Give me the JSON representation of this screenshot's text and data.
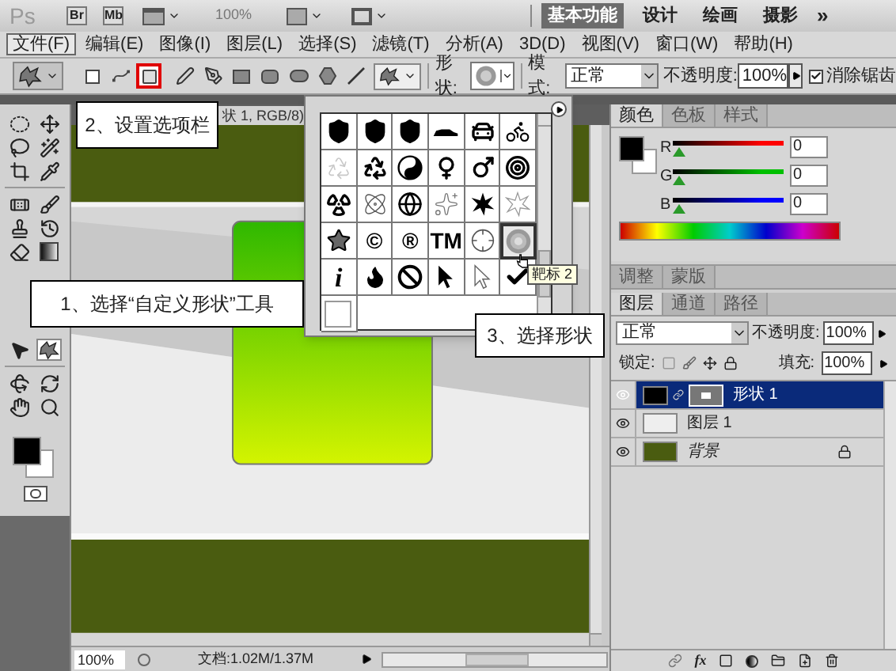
{
  "app_bar": {
    "logo": "Ps",
    "bridges": [
      "Br",
      "Mb"
    ],
    "zoom": "100%",
    "workspaces": [
      {
        "label": "基本功能",
        "selected": true
      },
      {
        "label": "设计",
        "selected": false
      },
      {
        "label": "绘画",
        "selected": false
      },
      {
        "label": "摄影",
        "selected": false
      }
    ],
    "more": "»"
  },
  "menu": [
    {
      "label": "文件(F)",
      "selected": true
    },
    {
      "label": "编辑(E)",
      "selected": false
    },
    {
      "label": "图像(I)",
      "selected": false
    },
    {
      "label": "图层(L)",
      "selected": false
    },
    {
      "label": "选择(S)",
      "selected": false
    },
    {
      "label": "滤镜(T)",
      "selected": false
    },
    {
      "label": "分析(A)",
      "selected": false
    },
    {
      "label": "3D(D)",
      "selected": false
    },
    {
      "label": "视图(V)",
      "selected": false
    },
    {
      "label": "窗口(W)",
      "selected": false
    },
    {
      "label": "帮助(H)",
      "selected": false
    }
  ],
  "options_bar": {
    "modes": [
      {
        "kind": "shape-layer",
        "selected": false
      },
      {
        "kind": "paths",
        "selected": false
      },
      {
        "kind": "fill-pixels",
        "selected": true
      }
    ],
    "tools": [
      {
        "kind": "pen"
      },
      {
        "kind": "freeform-pen"
      },
      {
        "kind": "rectangle"
      },
      {
        "kind": "rounded-rectangle"
      },
      {
        "kind": "ellipse"
      },
      {
        "kind": "polygon"
      },
      {
        "kind": "line"
      },
      {
        "kind": "custom-shape"
      }
    ],
    "shape_label": "形状:",
    "mode_label": "模式:",
    "mode_value": "正常",
    "opacity_label": "不透明度:",
    "opacity_value": "100%",
    "antialias": {
      "label": "消除锯齿",
      "checked": true
    }
  },
  "toolbox": {
    "tools": [
      {
        "kind": "ellipse-marquee",
        "selected": false
      },
      {
        "kind": "move",
        "selected": false
      },
      {
        "kind": "lasso",
        "selected": false
      },
      {
        "kind": "magic-wand",
        "selected": false
      },
      {
        "kind": "crop",
        "selected": false
      },
      {
        "kind": "eyedropper",
        "selected": false
      },
      {
        "kind": "healing",
        "selected": false
      },
      {
        "kind": "brush",
        "selected": false
      },
      {
        "kind": "stamp",
        "selected": false
      },
      {
        "kind": "history-brush",
        "selected": false
      },
      {
        "kind": "eraser",
        "selected": false
      },
      {
        "kind": "gradient",
        "selected": false
      },
      {
        "kind": "path-select",
        "selected": false
      },
      {
        "kind": "custom-shape",
        "selected": true
      },
      {
        "kind": "rotate-3d",
        "selected": false
      },
      {
        "kind": "orbit-3d",
        "selected": false
      },
      {
        "kind": "hand",
        "selected": false
      },
      {
        "kind": "zoom",
        "selected": false
      }
    ]
  },
  "document": {
    "tab_title": "状 1, RGB/8)",
    "status_zoom": "100%",
    "status_doc": "文档:1.02M/1.37M"
  },
  "shape_picker": {
    "tooltip": "靶标 2",
    "shapes": [
      {
        "kind": "shield",
        "selected": false
      },
      {
        "kind": "shield",
        "selected": false
      },
      {
        "kind": "shield",
        "selected": false
      },
      {
        "kind": "car-side",
        "selected": false
      },
      {
        "kind": "car",
        "selected": false
      },
      {
        "kind": "bicycle",
        "selected": false
      },
      {
        "kind": "recycle-faint",
        "selected": false
      },
      {
        "kind": "recycle",
        "selected": false
      },
      {
        "kind": "yin-yang",
        "selected": false
      },
      {
        "kind": "female",
        "selected": false
      },
      {
        "kind": "male",
        "selected": false
      },
      {
        "kind": "target",
        "selected": false
      },
      {
        "kind": "radiation",
        "selected": false
      },
      {
        "kind": "atom",
        "selected": false
      },
      {
        "kind": "globe",
        "selected": false
      },
      {
        "kind": "sparkle",
        "selected": false
      },
      {
        "kind": "burst",
        "selected": false
      },
      {
        "kind": "burst-outline",
        "selected": false
      },
      {
        "kind": "star",
        "selected": false
      },
      {
        "kind": "glyph",
        "text": "©",
        "selected": false
      },
      {
        "kind": "glyph",
        "text": "®",
        "selected": false
      },
      {
        "kind": "glyph",
        "text": "TM",
        "selected": false
      },
      {
        "kind": "crosshair",
        "selected": false
      },
      {
        "kind": "radial",
        "selected": true
      },
      {
        "kind": "info",
        "text": "i",
        "selected": false
      },
      {
        "kind": "fire",
        "selected": false
      },
      {
        "kind": "no-sign",
        "selected": false
      },
      {
        "kind": "cursor",
        "selected": false
      },
      {
        "kind": "cursor-outline",
        "selected": false
      },
      {
        "kind": "check",
        "selected": false
      },
      {
        "kind": "blank",
        "selected": false
      }
    ]
  },
  "callouts": [
    {
      "text": "2、设置选项栏"
    },
    {
      "text": "1、选择“自定义形状”工具"
    },
    {
      "text": "3、选择形状"
    }
  ],
  "color_panel": {
    "tabs": [
      {
        "label": "颜色",
        "selected": true
      },
      {
        "label": "色板",
        "selected": false
      },
      {
        "label": "样式",
        "selected": false
      }
    ],
    "channels": [
      {
        "name": "R",
        "level": 0,
        "value": "0",
        "color": "#ff0000"
      },
      {
        "name": "G",
        "level": 0,
        "value": "0",
        "color": "#00c000"
      },
      {
        "name": "B",
        "level": 0,
        "value": "0",
        "color": "#0000ff"
      }
    ]
  },
  "adjust_panel": {
    "tabs": [
      "调整",
      "蒙版"
    ]
  },
  "layers_panel": {
    "tabs": [
      {
        "label": "图层",
        "selected": true
      },
      {
        "label": "通道",
        "selected": false
      },
      {
        "label": "路径",
        "selected": false
      }
    ],
    "blend": "正常",
    "opacity_label": "不透明度:",
    "opacity_value": "100%",
    "lock_label": "锁定:",
    "fill_label": "填充:",
    "fill_value": "100%",
    "effects_button": "fx",
    "layers": [
      {
        "name": "形状 1",
        "kind": "shape",
        "selected": true,
        "visible": true,
        "locked": false
      },
      {
        "name": "图层 1",
        "kind": "pixel",
        "selected": false,
        "visible": true,
        "locked": false
      },
      {
        "name": "背景",
        "kind": "background",
        "selected": false,
        "visible": true,
        "locked": true
      }
    ]
  }
}
